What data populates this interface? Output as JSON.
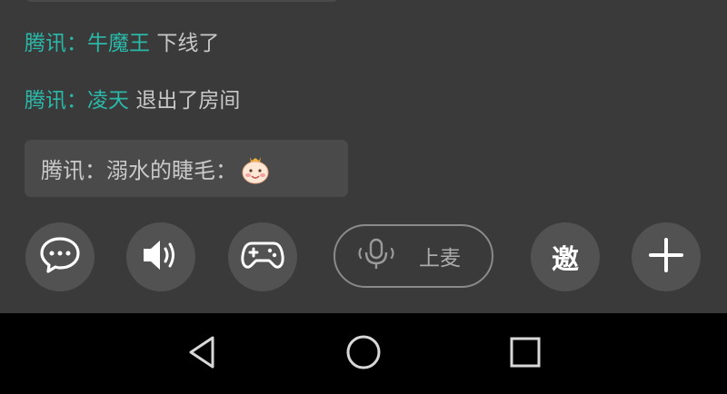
{
  "chat": {
    "system_messages": [
      {
        "source": "腾讯",
        "separator": "：",
        "name": "牛魔王",
        "action": "下线了"
      },
      {
        "source": "腾讯",
        "separator": "：",
        "name": "凌天",
        "action": "退出了房间"
      }
    ],
    "bubble": {
      "text": "腾讯：溺水的睫毛：",
      "emoji": "baby-face-emoji"
    }
  },
  "toolbar": {
    "chat_icon": "chat-bubble-icon",
    "sound_icon": "speaker-icon",
    "game_icon": "gamepad-icon",
    "mic_label": "上麦",
    "mic_icon": "microphone-icon",
    "invite_label": "邀",
    "add_icon": "plus-icon"
  },
  "navigation": {
    "back_icon": "back-triangle-icon",
    "home_icon": "home-circle-icon",
    "recent_icon": "recent-apps-square-icon"
  },
  "colors": {
    "background": "#3a3a3a",
    "accent_teal": "#2bb8a8",
    "button_bg": "#525252",
    "nav_bg": "#000000"
  }
}
